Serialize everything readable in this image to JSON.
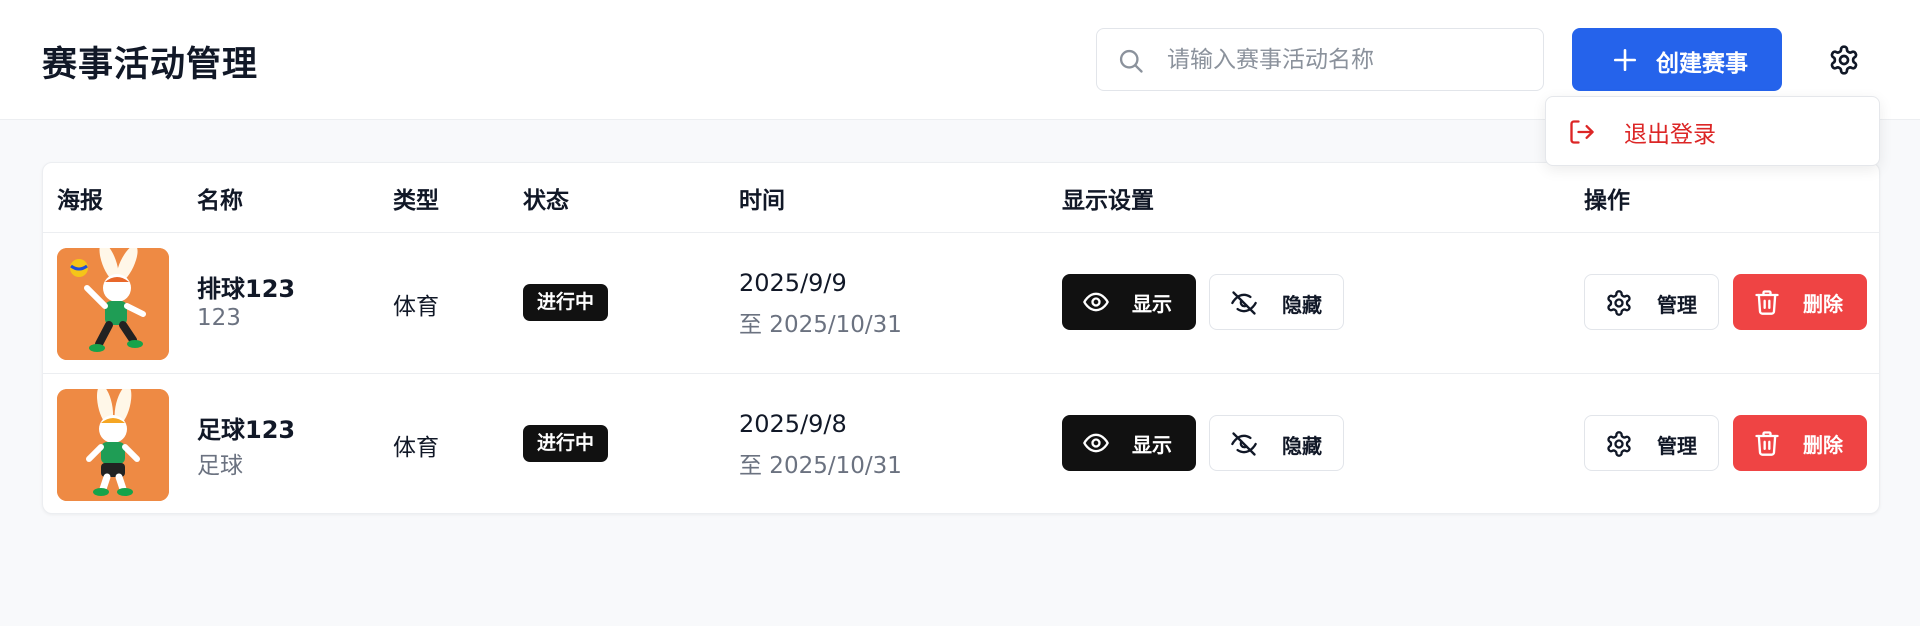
{
  "header": {
    "title": "赛事活动管理",
    "search_placeholder": "请输入赛事活动名称",
    "create_label": "创建赛事"
  },
  "user_menu": {
    "logout_label": "退出登录"
  },
  "table": {
    "columns": [
      "海报",
      "名称",
      "类型",
      "状态",
      "时间",
      "显示设置",
      "操作"
    ],
    "rows": [
      {
        "name": "排球123",
        "subtitle": "123",
        "type": "体育",
        "status": "进行中",
        "start": "2025/9/9",
        "end": "至 2025/10/31",
        "show_label": "显示",
        "hide_label": "隐藏",
        "manage_label": "管理",
        "delete_label": "删除"
      },
      {
        "name": "足球123",
        "subtitle": "足球",
        "type": "体育",
        "status": "进行中",
        "start": "2025/9/8",
        "end": "至 2025/10/31",
        "show_label": "显示",
        "hide_label": "隐藏",
        "manage_label": "管理",
        "delete_label": "删除"
      }
    ]
  },
  "colors": {
    "primary": "#2563eb",
    "danger": "#ef4444",
    "logout_text": "#dc2626",
    "badge_bg": "#111111",
    "poster_bg": "#ee8a44"
  },
  "icons": [
    "search-icon",
    "plus-icon",
    "gear-icon",
    "logout-icon",
    "eye-icon",
    "eye-off-icon",
    "trash-icon"
  ]
}
